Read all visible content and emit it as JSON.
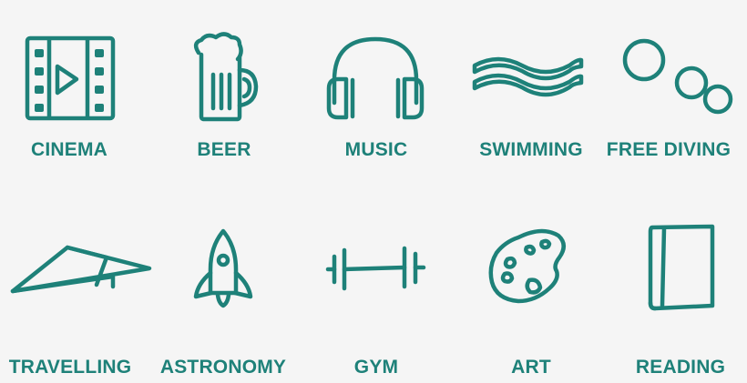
{
  "accent_color": "#1e8179",
  "background_color": "#f5f5f5",
  "items": [
    {
      "label": "CINEMA",
      "icon": "film-strip-play-icon"
    },
    {
      "label": "BEER",
      "icon": "beer-mug-icon"
    },
    {
      "label": "MUSIC",
      "icon": "headphones-icon"
    },
    {
      "label": "SWIMMING",
      "icon": "waves-icon"
    },
    {
      "label": "FREE DIVING",
      "icon": "bubbles-icon"
    },
    {
      "label": "TRAVELLING",
      "icon": "paper-plane-icon"
    },
    {
      "label": "ASTRONOMY",
      "icon": "rocket-icon"
    },
    {
      "label": "GYM",
      "icon": "dumbbell-icon"
    },
    {
      "label": "ART",
      "icon": "paint-palette-icon"
    },
    {
      "label": "READING",
      "icon": "book-icon"
    }
  ]
}
